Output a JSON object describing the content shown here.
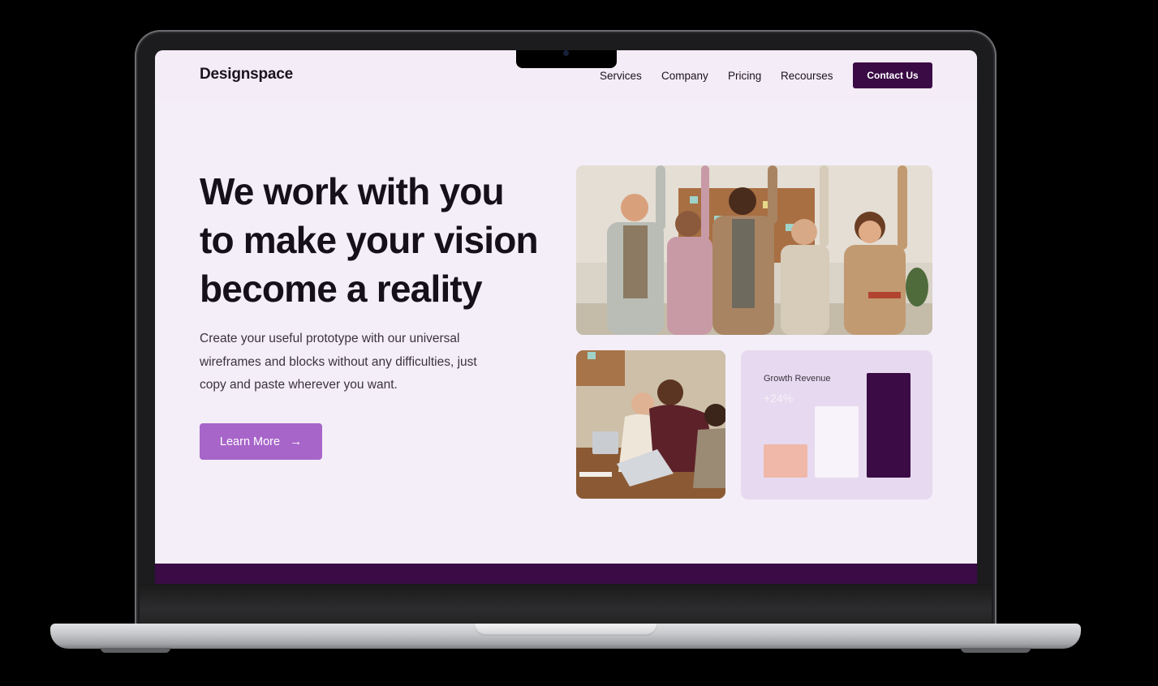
{
  "brand": {
    "logo": "Designspace"
  },
  "nav": {
    "links": [
      "Services",
      "Company",
      "Pricing",
      "Recourses"
    ],
    "cta_label": "Contact Us"
  },
  "hero": {
    "title_lines": [
      "We work with you",
      "to make your vision",
      "become a reality"
    ],
    "subtitle_lines": [
      "Create your useful prototype with our universal",
      "wireframes and blocks without any difficulties, just",
      "copy and paste wherever you want."
    ],
    "button_label": "Learn More",
    "button_icon": "arrow-right-icon"
  },
  "stats_card": {
    "label": "Growth Revenue",
    "value": "+24%",
    "bars": [
      {
        "level": 0.32,
        "color": "#f0b8a8"
      },
      {
        "level": 0.68,
        "color": "#f8f2fa"
      },
      {
        "level": 1.0,
        "color": "#3a0b45"
      }
    ]
  },
  "colors": {
    "page_bg": "#f4eef8",
    "brand_dark": "#3a0b45",
    "accent": "#a765c9",
    "card_bg": "#e7d9ef"
  }
}
